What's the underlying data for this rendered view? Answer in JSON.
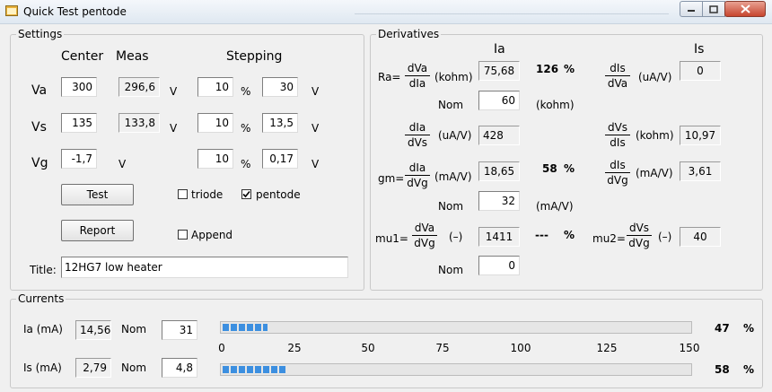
{
  "window": {
    "title": "Quick Test pentode"
  },
  "settings": {
    "label": "Settings",
    "col_center": "Center",
    "col_meas": "Meas",
    "col_stepping": "Stepping",
    "rows": [
      {
        "label": "Va",
        "center": "300",
        "meas": "296,6",
        "unit1": "V",
        "step_pct": "10",
        "pct": "%",
        "step_val": "30",
        "unit2": "V"
      },
      {
        "label": "Vs",
        "center": "135",
        "meas": "133,8",
        "unit1": "V",
        "step_pct": "10",
        "pct": "%",
        "step_val": "13,5",
        "unit2": "V"
      },
      {
        "label": "Vg",
        "center": "-1,7",
        "unit1": "V",
        "step_pct": "10",
        "pct": "%",
        "step_val": "0,17",
        "unit2": "V"
      }
    ],
    "test_button": "Test",
    "report_button": "Report",
    "triode_label": "triode",
    "triode_checked": false,
    "pentode_label": "pentode",
    "pentode_checked": true,
    "append_label": "Append",
    "append_checked": false,
    "title_label": "Title:",
    "title_value": "12HG7 low heater"
  },
  "derivatives": {
    "label": "Derivatives",
    "col_ia": "Ia",
    "col_is": "Is",
    "ra": {
      "prefix": "Ra=",
      "num": "dVa",
      "den": "dIa",
      "unit": "(kohm)",
      "value": "75,68",
      "pct_value": "126",
      "pct": "%",
      "nom_label": "Nom",
      "nom_value": "60",
      "nom_unit": "(kohm)"
    },
    "dis_dva": {
      "num": "dIs",
      "den": "dVa",
      "unit": "(uA/V)",
      "value": "0"
    },
    "dia_dvs": {
      "num": "dIa",
      "den": "dVs",
      "unit": "(uA/V)",
      "value": "428"
    },
    "dvs_dis": {
      "num": "dVs",
      "den": "dIs",
      "unit": "(kohm)",
      "value": "10,97"
    },
    "gm": {
      "prefix": "gm=",
      "num": "dIa",
      "den": "dVg",
      "unit": "(mA/V)",
      "value": "18,65",
      "pct_value": "58",
      "pct": "%",
      "nom_label": "Nom",
      "nom_value": "32",
      "nom_unit": "(mA/V)"
    },
    "dis_dvg": {
      "num": "dIs",
      "den": "dVg",
      "unit": "(mA/V)",
      "value": "3,61"
    },
    "mu1": {
      "prefix": "mu1=",
      "num": "dVa",
      "den": "dVg",
      "unit": "(–)",
      "value": "1411",
      "pct_value": "---",
      "pct": "%",
      "nom_label": "Nom",
      "nom_value": "0"
    },
    "mu2": {
      "prefix": "mu2=",
      "num": "dVs",
      "den": "dVg",
      "unit": "(–)",
      "value": "40"
    }
  },
  "currents": {
    "label": "Currents",
    "ia": {
      "label": "Ia (mA)",
      "value": "14,56",
      "nom_label": "Nom",
      "nom_value": "31",
      "pct_value": "47",
      "pct": "%",
      "level_fraction": 0.097
    },
    "is": {
      "label": "Is (mA)",
      "value": "2,79",
      "nom_label": "Nom",
      "nom_value": "4,8",
      "pct_value": "58",
      "pct": "%",
      "level_fraction": 0.139
    },
    "scale": [
      "0",
      "25",
      "50",
      "75",
      "100",
      "125",
      "150"
    ]
  },
  "colors": {
    "progress_fill": "#3c8fe0"
  }
}
